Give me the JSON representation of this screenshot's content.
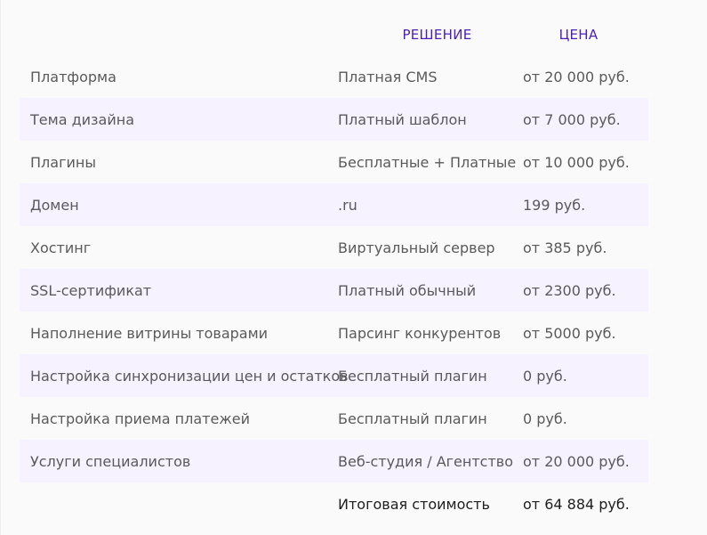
{
  "header": {
    "col_solution": "РЕШЕНИЕ",
    "col_price": "ЦЕНА"
  },
  "rows": [
    {
      "item": "Платформа",
      "solution": "Платная CMS",
      "price": "от 20 000 руб."
    },
    {
      "item": "Тема дизайна",
      "solution": "Платный шаблон",
      "price": "от 7 000 руб."
    },
    {
      "item": "Плагины",
      "solution": "Бесплатные + Платные",
      "price": "от 10 000 руб."
    },
    {
      "item": "Домен",
      "solution": ".ru",
      "price": "199 руб."
    },
    {
      "item": "Хостинг",
      "solution": "Виртуальный сервер",
      "price": "от 385 руб."
    },
    {
      "item": "SSL-сертификат",
      "solution": "Платный обычный",
      "price": "от 2300 руб."
    },
    {
      "item": "Наполнение витрины товарами",
      "solution": "Парсинг конкурентов",
      "price": "от 5000 руб."
    },
    {
      "item": "Настройка синхронизации цен и остатков",
      "solution": "Бесплатный плагин",
      "price": "0 руб."
    },
    {
      "item": "Настройка приема платежей",
      "solution": "Бесплатный плагин",
      "price": "0 руб."
    },
    {
      "item": "Услуги специалистов",
      "solution": "Веб-студия / Агентство",
      "price": "от 20 000 руб."
    }
  ],
  "total": {
    "label": "Итоговая стоимость",
    "price": "от 64 884 руб."
  }
}
